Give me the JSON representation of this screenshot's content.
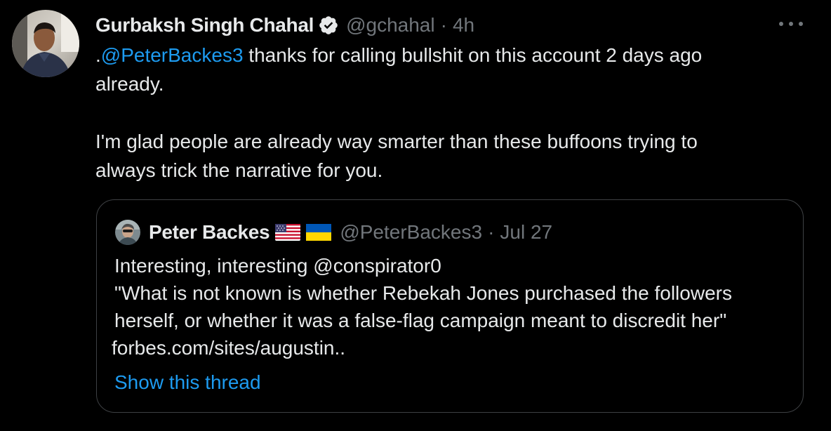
{
  "tweet": {
    "author_name": "Gurbaksh Singh Chahal",
    "handle": "@gchahal",
    "separator": "·",
    "time": "4h",
    "verified_icon": "verified-badge-icon",
    "more_icon": "more-options-icon",
    "body": {
      "prefix": ".",
      "mention": "@PeterBackes3",
      "line1_rest": " thanks for calling bullshit on this account 2 days ago",
      "line2": "already.",
      "paragraph2_line1": "I'm glad people are already way smarter than these buffoons trying to",
      "paragraph2_line2": "always trick the narrative for you."
    }
  },
  "quoted_tweet": {
    "author_name": "Peter Backes",
    "flags": [
      "us-flag-icon",
      "ukraine-flag-icon"
    ],
    "handle": "@PeterBackes3",
    "separator": "·",
    "time": "Jul 27",
    "body": {
      "line1": "Interesting, interesting @conspirator0",
      "line2": "\"What is not known is whether Rebekah Jones purchased the followers",
      "line3": "herself, or whether it was a false-flag campaign meant to discredit her\"",
      "link": "forbes.com/sites/augustin.."
    },
    "show_thread_label": "Show this thread"
  },
  "colors": {
    "background": "#000000",
    "text": "#e7e9ea",
    "muted": "#71767b",
    "link": "#1d9bf0",
    "border": "#3e4144"
  }
}
